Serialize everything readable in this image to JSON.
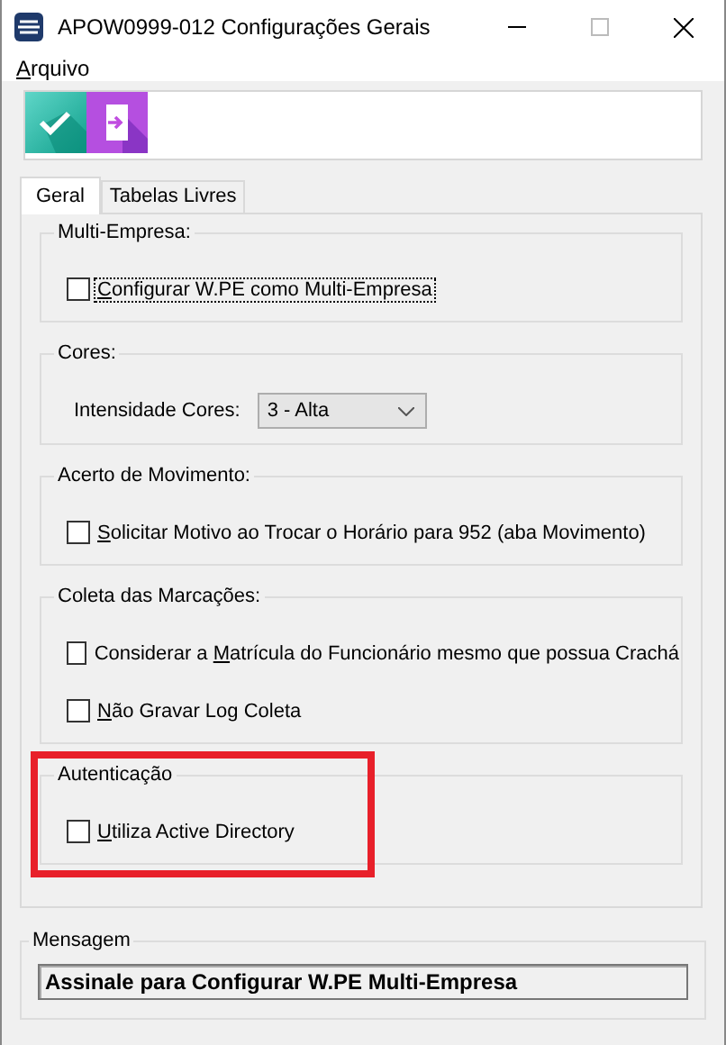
{
  "window": {
    "title": "APOW0999-012 Configurações Gerais"
  },
  "menu": [
    {
      "key": "A",
      "post": "rquivo"
    }
  ],
  "toolbar": [
    {
      "kind": "confirm"
    },
    {
      "kind": "exit"
    }
  ],
  "tabs": [
    {
      "label": "Geral",
      "selected": true
    },
    {
      "label": "Tabelas Livres",
      "selected": false
    }
  ],
  "groups": [
    {
      "title": "Multi-Empresa:",
      "items": [
        {
          "kind": "checkbox",
          "key": "C",
          "post": "onfigurar W.PE como Multi-Empresa",
          "checked": false,
          "focused": true
        }
      ]
    },
    {
      "title": "Cores:",
      "items": [
        {
          "kind": "select",
          "label": "Intensidade Cores:",
          "value": "3 - Alta"
        }
      ]
    },
    {
      "title": "Acerto de Movimento:",
      "items": [
        {
          "kind": "checkbox",
          "key": "S",
          "post": "olicitar Motivo ao Trocar o Horário para 952 (aba Movimento)",
          "checked": false,
          "focused": false
        }
      ]
    },
    {
      "title": "Coleta das Marcações:",
      "items": [
        {
          "kind": "checkbox",
          "pre": "Considerar a ",
          "key": "M",
          "post": "atrícula do Funcionário mesmo que possua Crachá",
          "checked": false,
          "focused": false
        },
        {
          "kind": "checkbox",
          "key": "N",
          "post": "ão Gravar Log Coleta",
          "checked": false,
          "focused": false
        }
      ]
    },
    {
      "title": "Autenticação",
      "highlighted": true,
      "items": [
        {
          "kind": "checkbox",
          "key": "U",
          "post": "tiliza Active Directory",
          "checked": false,
          "focused": false
        }
      ]
    }
  ],
  "message": {
    "title": "Mensagem",
    "value": "Assinale para Configurar W.PE Multi-Empresa"
  }
}
